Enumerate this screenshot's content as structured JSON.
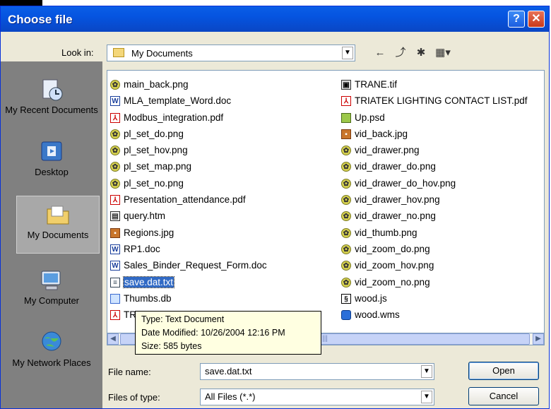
{
  "window": {
    "title": "Choose file",
    "help_label": "?",
    "close_label": "✕"
  },
  "toolbar": {
    "look_in_label": "Look in:",
    "look_in_value": "My Documents",
    "back_icon": "←",
    "up_icon": "⤴",
    "new_folder_icon": "✱",
    "views_icon": "▦▾"
  },
  "places": [
    {
      "label": "My Recent Documents",
      "icon": "recent-documents-icon"
    },
    {
      "label": "Desktop",
      "icon": "desktop-icon"
    },
    {
      "label": "My Documents",
      "icon": "my-documents-icon",
      "selected": true
    },
    {
      "label": "My Computer",
      "icon": "my-computer-icon"
    },
    {
      "label": "My Network Places",
      "icon": "network-places-icon"
    }
  ],
  "files": {
    "column1": [
      {
        "name": "main_back.png",
        "type": "png"
      },
      {
        "name": "MLA_template_Word.doc",
        "type": "doc"
      },
      {
        "name": "Modbus_integration.pdf",
        "type": "pdf"
      },
      {
        "name": "pl_set_do.png",
        "type": "png"
      },
      {
        "name": "pl_set_hov.png",
        "type": "png"
      },
      {
        "name": "pl_set_map.png",
        "type": "png"
      },
      {
        "name": "pl_set_no.png",
        "type": "png"
      },
      {
        "name": "Presentation_attendance.pdf",
        "type": "pdf"
      },
      {
        "name": "query.htm",
        "type": "htm"
      },
      {
        "name": "Regions.jpg",
        "type": "jpg"
      },
      {
        "name": "RP1.doc",
        "type": "doc"
      },
      {
        "name": "Sales_Binder_Request_Form.doc",
        "type": "doc"
      },
      {
        "name": "save.dat.txt",
        "type": "txt",
        "selected": true
      },
      {
        "name": "Thumbs.db",
        "type": "db"
      },
      {
        "name": "TR",
        "type": "pdf"
      }
    ],
    "column2": [
      {
        "name": "TRANE.tif",
        "type": "tif"
      },
      {
        "name": "TRIATEK LIGHTING CONTACT LIST.pdf",
        "type": "pdf"
      },
      {
        "name": "Up.psd",
        "type": "psd"
      },
      {
        "name": "vid_back.jpg",
        "type": "jpg"
      },
      {
        "name": "vid_drawer.png",
        "type": "png"
      },
      {
        "name": "vid_drawer_do.png",
        "type": "png"
      },
      {
        "name": "vid_drawer_do_hov.png",
        "type": "png"
      },
      {
        "name": "vid_drawer_hov.png",
        "type": "png"
      },
      {
        "name": "vid_drawer_no.png",
        "type": "png"
      },
      {
        "name": "vid_thumb.png",
        "type": "png"
      },
      {
        "name": "vid_zoom_do.png",
        "type": "png"
      },
      {
        "name": "vid_zoom_hov.png",
        "type": "png"
      },
      {
        "name": "vid_zoom_no.png",
        "type": "png"
      },
      {
        "name": "wood.js",
        "type": "js"
      },
      {
        "name": "wood.wms",
        "type": "wms"
      }
    ]
  },
  "tooltip": {
    "type": "Type: Text Document",
    "modified": "Date Modified: 10/26/2004 12:16 PM",
    "size": "Size: 585 bytes"
  },
  "scrollbar": {
    "left_arrow": "◀",
    "right_arrow": "▶",
    "grip": "|||"
  },
  "form": {
    "file_name_label": "File name:",
    "file_name_value": "save.dat.txt",
    "file_type_label": "Files of type:",
    "file_type_value": "All Files (*.*)",
    "open_label": "Open",
    "cancel_label": "Cancel"
  },
  "colors": {
    "titlebar": "#0a5ee6",
    "selection": "#316ac5",
    "places_bg": "#808080"
  }
}
